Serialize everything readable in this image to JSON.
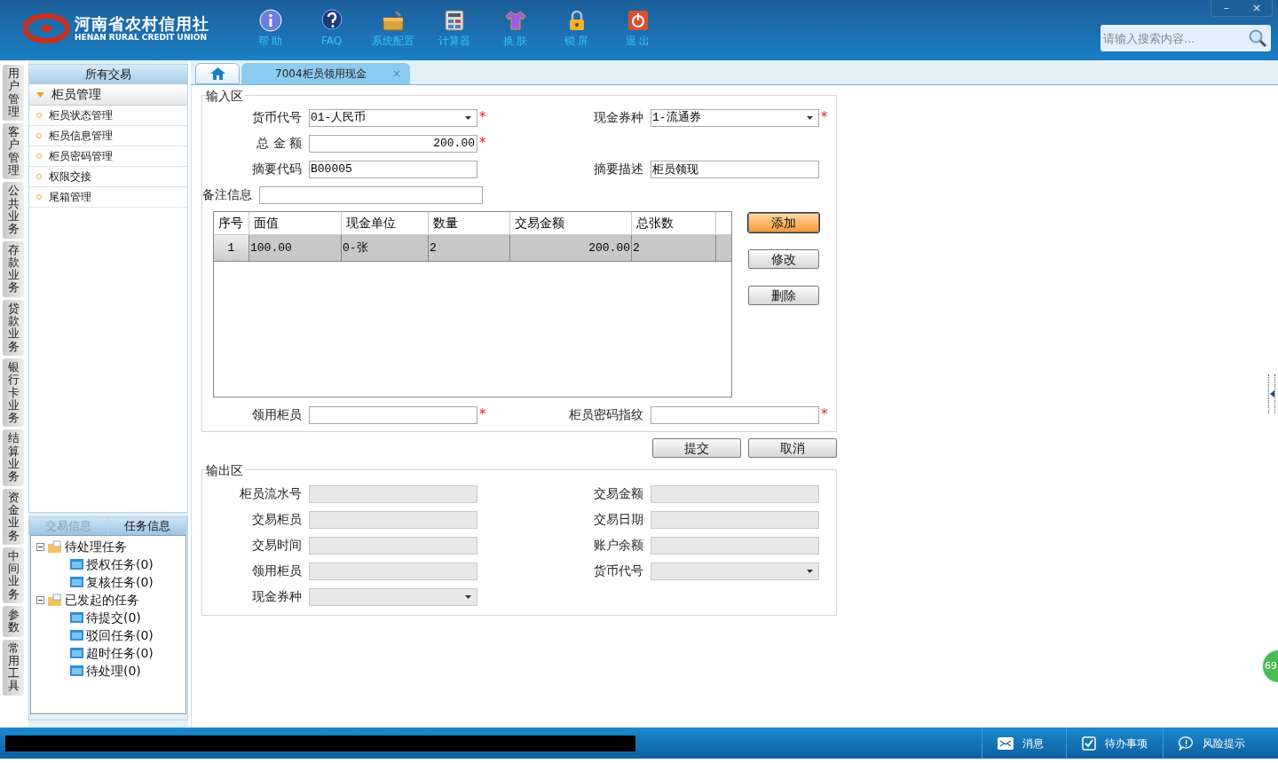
{
  "header": {
    "logo_title": "河南省农村信用社",
    "logo_subtitle": "HENAN RURAL CREDIT UNION",
    "toolbar": [
      {
        "kind": "info",
        "label": "帮 助"
      },
      {
        "kind": "faq",
        "label": "FAQ"
      },
      {
        "kind": "toolbox",
        "label": "系统配置"
      },
      {
        "kind": "calculator",
        "label": "计算器"
      },
      {
        "kind": "shirt",
        "label": "换 肤"
      },
      {
        "kind": "lock",
        "label": "锁 屏"
      },
      {
        "kind": "power",
        "label": "退 出"
      }
    ],
    "window_buttons": [
      "–",
      "×"
    ],
    "search": {
      "placeholder": "请输入搜索内容..."
    }
  },
  "side_tabs": [
    {
      "label": "用户管理"
    },
    {
      "label": "客户管理"
    },
    {
      "label": "公共业务"
    },
    {
      "label": "存款业务"
    },
    {
      "label": "贷款业务"
    },
    {
      "label": "银行卡业务"
    },
    {
      "label": "结算业务"
    },
    {
      "label": "资金业务"
    },
    {
      "label": "中间业务"
    },
    {
      "label": "参数"
    },
    {
      "label": "常用工具"
    }
  ],
  "sidebar": {
    "title": "所有交易",
    "group": {
      "label": "柜员管理",
      "expanded": true,
      "items": [
        {
          "label": "柜员状态管理"
        },
        {
          "label": "柜员信息管理"
        },
        {
          "label": "柜员密码管理"
        },
        {
          "label": "权限交接"
        },
        {
          "label": "尾箱管理"
        }
      ]
    },
    "info_tabs": [
      {
        "label": "交易信息",
        "selected": false
      },
      {
        "label": "任务信息",
        "selected": true
      }
    ],
    "task_tree": [
      {
        "label": "待处理任务",
        "expanded": true,
        "children": [
          {
            "label": "授权任务(0)"
          },
          {
            "label": "复核任务(0)"
          }
        ]
      },
      {
        "label": "已发起的任务",
        "expanded": true,
        "children": [
          {
            "label": "待提交(0)"
          },
          {
            "label": "驳回任务(0)"
          },
          {
            "label": "超时任务(0)"
          },
          {
            "label": "待处理(0)"
          }
        ]
      }
    ]
  },
  "tabs": [
    {
      "kind": "home",
      "selected": false
    },
    {
      "kind": "page",
      "label": "7004柜员领用现金",
      "selected": true,
      "close": "×"
    }
  ],
  "input_area": {
    "title": "输入区",
    "rows": [
      [
        {
          "label": "货币代号",
          "kind": "select",
          "value": "01-人民币",
          "required_mark": "*"
        },
        {
          "label": "现金券种",
          "kind": "select",
          "value": "1-流通券",
          "required_mark": "*"
        }
      ],
      [
        {
          "label": "总 金 额",
          "kind": "amount",
          "value": "200.00",
          "required_mark": "*"
        }
      ],
      [
        {
          "label": "摘要代码",
          "kind": "text",
          "value": "B00005"
        },
        {
          "label": "摘要描述",
          "kind": "text",
          "value": "柜员领现"
        }
      ],
      [
        {
          "label": "备注信息",
          "kind": "wide"
        }
      ]
    ],
    "table": {
      "columns": [
        "序号",
        "面值",
        "现金单位",
        "数量",
        "交易金额",
        "总张数"
      ],
      "rows": [
        {
          "selected": true,
          "cells": [
            "1",
            "100.00",
            "0-张",
            "2",
            "200.00",
            "2"
          ]
        }
      ]
    },
    "buttons": [
      {
        "label": "添加",
        "focused": true
      },
      {
        "label": "修改",
        "focused": false
      },
      {
        "label": "删除",
        "focused": false
      }
    ],
    "bottom_row": [
      {
        "label": "领用柜员",
        "kind": "text",
        "required_mark": "*"
      },
      {
        "label": "柜员密码指纹",
        "kind": "text",
        "required_mark": "*"
      }
    ]
  },
  "actions": [
    {
      "label": "提交"
    },
    {
      "label": "取消"
    }
  ],
  "output_area": {
    "title": "输出区",
    "fields": [
      {
        "label": "柜员流水号",
        "kind": "text"
      },
      {
        "label": "交易金额",
        "kind": "text"
      },
      {
        "label": "交易柜员",
        "kind": "text"
      },
      {
        "label": "交易日期",
        "kind": "text"
      },
      {
        "label": "交易时间",
        "kind": "text"
      },
      {
        "label": "账户余额",
        "kind": "text"
      },
      {
        "label": "领用柜员",
        "kind": "text"
      },
      {
        "label": "货币代号",
        "kind": "select"
      },
      {
        "label": "现金券种",
        "kind": "select"
      }
    ]
  },
  "float_badge": "69",
  "status_bar": [
    {
      "kind": "mail",
      "label": "消息"
    },
    {
      "kind": "check",
      "label": "待办事项"
    },
    {
      "kind": "alert",
      "label": "风险提示"
    }
  ]
}
